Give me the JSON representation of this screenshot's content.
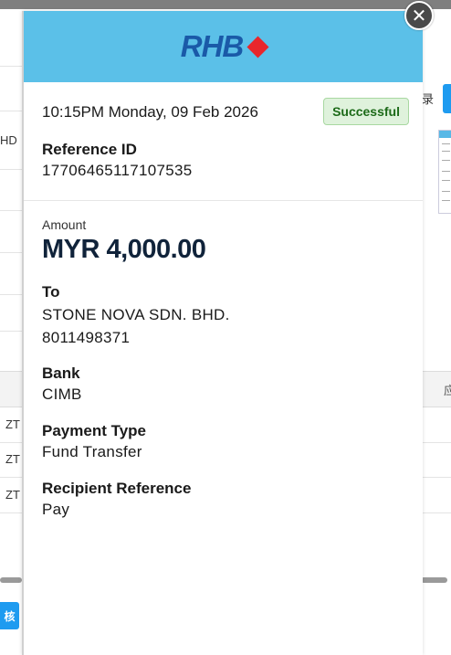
{
  "background": {
    "left_fragments": [
      "HD",
      "ZT",
      "ZT",
      "ZT"
    ],
    "audit_button_label": "核",
    "right_glyph": "录",
    "right_header_glyph": "应"
  },
  "receipt": {
    "bank_logo_text": "RHB",
    "datetime": "10:15PM Monday, 09 Feb 2026",
    "status": "Successful",
    "reference_id_label": "Reference ID",
    "reference_id": "17706465117107535",
    "amount_label": "Amount",
    "amount": "MYR 4,000.00",
    "to_label": "To",
    "recipient_name": "STONE NOVA SDN. BHD.",
    "recipient_account": "8011498371",
    "bank_label": "Bank",
    "bank": "CIMB",
    "payment_type_label": "Payment Type",
    "payment_type": "Fund Transfer",
    "recipient_reference_label": "Recipient Reference",
    "recipient_reference": "Pay"
  },
  "colors": {
    "header": "#5bc0e8",
    "logo_blue": "#1a5aa8",
    "logo_red": "#e8262b",
    "status_green": "#1c6a18"
  },
  "icons": {
    "close": "close-icon"
  }
}
